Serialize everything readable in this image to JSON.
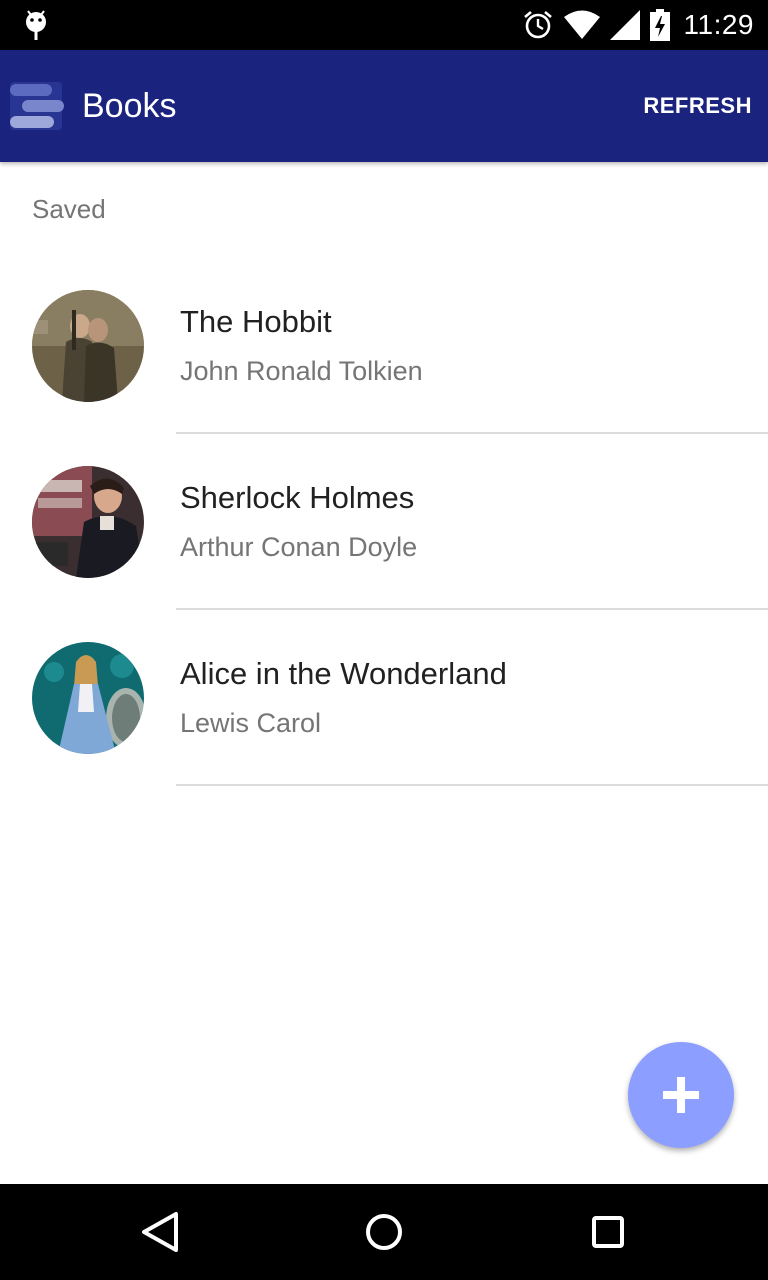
{
  "status_bar": {
    "time": "11:29",
    "icons": [
      "android-debug-icon",
      "alarm-icon",
      "wifi-icon",
      "cell-signal-icon",
      "battery-charging-icon"
    ]
  },
  "app_bar": {
    "title": "Books",
    "refresh_label": "REFRESH",
    "color": "#1a237e",
    "logo_icon": "books-stack-logo"
  },
  "main": {
    "section_header": "Saved",
    "books": [
      {
        "title": "The Hobbit",
        "author": "John Ronald Tolkien",
        "cover": "hobbit-cover-image"
      },
      {
        "title": "Sherlock Holmes",
        "author": "Arthur Conan Doyle",
        "cover": "sherlock-cover-image"
      },
      {
        "title": "Alice in the Wonderland",
        "author": "Lewis Carol",
        "cover": "alice-cover-image"
      }
    ]
  },
  "fab": {
    "icon": "plus-icon",
    "color": "#8c9eff"
  },
  "nav_bar": {
    "icons": [
      "back-icon",
      "home-icon",
      "recents-icon"
    ]
  }
}
